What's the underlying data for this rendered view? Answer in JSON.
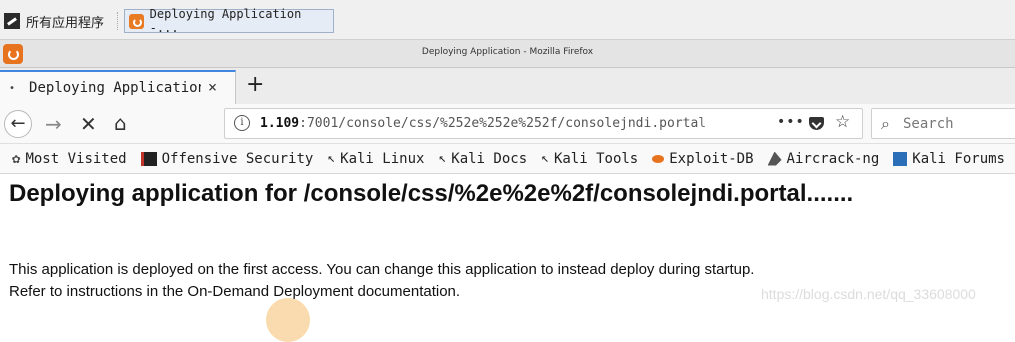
{
  "taskbar": {
    "apps_label": "所有应用程序",
    "task_label": "Deploying Application -..."
  },
  "window": {
    "title": "Deploying Application - Mozilla Firefox"
  },
  "tabs": [
    {
      "label": "Deploying Application",
      "close": "×"
    }
  ],
  "new_tab": "+",
  "nav": {
    "back": "←",
    "forward": "→",
    "stop": "✕",
    "home": "⌂",
    "url_host": "1.109",
    "url_rest": ":7001/console/css/%252e%252e%252f/consolejndi.portal",
    "more": "•••",
    "star": "☆"
  },
  "search": {
    "icon": "⌕",
    "placeholder": "Search"
  },
  "bookmarks": [
    {
      "label": "Most Visited",
      "icon": "gear-icon"
    },
    {
      "label": "Offensive Security",
      "icon": "offsec-icon"
    },
    {
      "label": "Kali Linux",
      "icon": "kali-dragon-icon"
    },
    {
      "label": "Kali Docs",
      "icon": "kali-dragon-icon"
    },
    {
      "label": "Kali Tools",
      "icon": "kali-dragon-icon"
    },
    {
      "label": "Exploit-DB",
      "icon": "exploitdb-icon"
    },
    {
      "label": "Aircrack-ng",
      "icon": "aircrack-icon"
    },
    {
      "label": "Kali Forums",
      "icon": "kali-forums-icon"
    }
  ],
  "page": {
    "heading": "Deploying application for /console/css/%2e%2e%2f/consolejndi.portal.......",
    "line1": "This application is deployed on the first access. You can change this application to instead deploy during startup.",
    "line2": "Refer to instructions in the On-Demand Deployment documentation.",
    "watermark": "https://blog.csdn.net/qq_33608000"
  },
  "colors": {
    "tab_accent": "#3e86e0",
    "firefox_orange": "#e8731f"
  }
}
